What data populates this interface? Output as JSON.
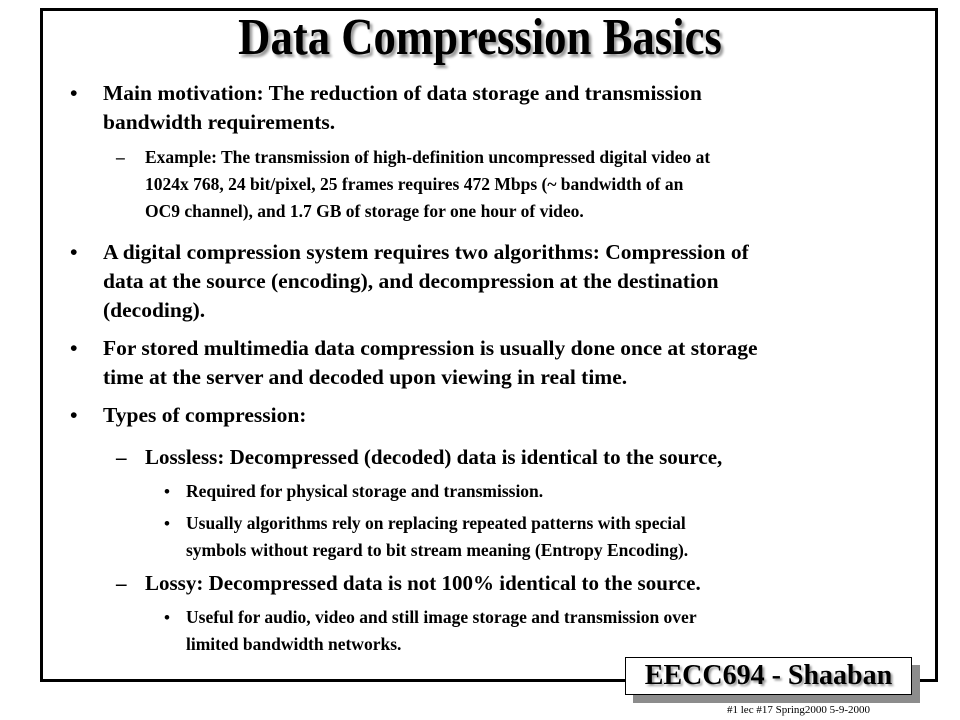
{
  "slide": {
    "title": "Data Compression Basics",
    "bullet_glyph": "•",
    "dash_glyph": "–",
    "items": [
      {
        "level": 1,
        "lines": [
          "Main motivation:  The reduction of data storage and transmission",
          "bandwidth requirements."
        ]
      },
      {
        "level": 2,
        "lines": [
          "Example: The transmission of high-definition uncompressed digital video at",
          "1024x 768,  24 bit/pixel,  25 frames requires 472 Mbps (~ bandwidth of an",
          "OC9 channel), and 1.7 GB of storage for one hour of video."
        ]
      },
      {
        "level": 1,
        "lines": [
          "A digital compression system requires two algorithms:  Compression of",
          "data at the source (encoding), and decompression at the destination",
          "(decoding)."
        ]
      },
      {
        "level": 1,
        "lines": [
          "For stored multimedia data compression is usually done once at storage",
          "time at the server and decoded upon viewing in real time."
        ]
      },
      {
        "level": 1,
        "lines": [
          "Types of compression:"
        ]
      },
      {
        "level": 2,
        "lines": [
          "Lossless:  Decompressed (decoded) data is identical to the source,"
        ]
      },
      {
        "level": 3,
        "lines": [
          "Required for physical storage and transmission."
        ]
      },
      {
        "level": 3,
        "lines": [
          "Usually algorithms rely on replacing repeated patterns with special",
          "symbols without regard to bit stream meaning (Entropy Encoding)."
        ]
      },
      {
        "level": 2,
        "lines": [
          "Lossy:  Decompressed data is not 100% identical to the source."
        ]
      },
      {
        "level": 3,
        "lines": [
          "Useful for audio, video and still image storage and transmission over",
          "limited bandwidth networks."
        ]
      }
    ]
  },
  "footer": {
    "course_label": "EECC694 - Shaaban",
    "note": "#1  lec #17   Spring2000   5-9-2000"
  }
}
